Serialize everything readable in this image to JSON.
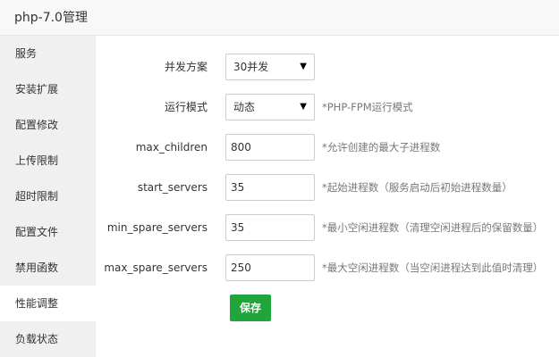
{
  "window": {
    "title": "php-7.0管理"
  },
  "sidebar": {
    "items": [
      {
        "label": "服务"
      },
      {
        "label": "安装扩展"
      },
      {
        "label": "配置修改"
      },
      {
        "label": "上传限制"
      },
      {
        "label": "超时限制"
      },
      {
        "label": "配置文件"
      },
      {
        "label": "禁用函数"
      },
      {
        "label": "性能调整",
        "active": true
      },
      {
        "label": "负载状态"
      }
    ]
  },
  "form": {
    "concurrency": {
      "label": "并发方案",
      "value": "30并发"
    },
    "run_mode": {
      "label": "运行模式",
      "value": "动态",
      "hint": "*PHP-FPM运行模式"
    },
    "max_children": {
      "label": "max_children",
      "value": "800",
      "hint": "*允许创建的最大子进程数"
    },
    "start_servers": {
      "label": "start_servers",
      "value": "35",
      "hint": "*起始进程数（服务启动后初始进程数量）"
    },
    "min_spare_servers": {
      "label": "min_spare_servers",
      "value": "35",
      "hint": "*最小空闲进程数（清理空闲进程后的保留数量）"
    },
    "max_spare_servers": {
      "label": "max_spare_servers",
      "value": "250",
      "hint": "*最大空闲进程数（当空闲进程达到此值时清理）"
    },
    "save_label": "保存"
  },
  "icons": {
    "dropdown": "chevron-down-icon"
  },
  "colors": {
    "save_button": "#20a53a",
    "sidebar_bg": "#f0f0f0",
    "active_item_bg": "#ffffff"
  }
}
